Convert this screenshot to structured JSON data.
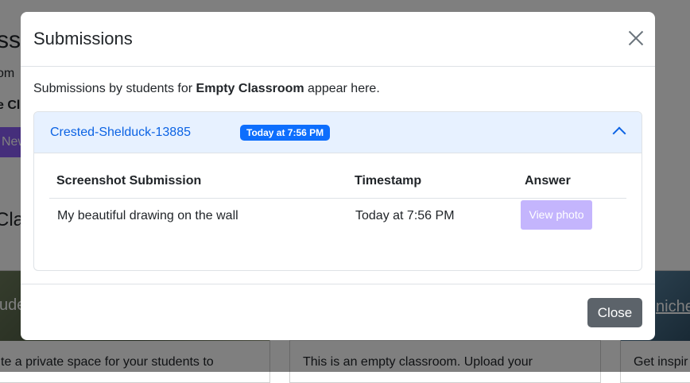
{
  "background": {
    "title_fragment": "ss",
    "line1_fragment": "om",
    "line2_fragment": "e Cl",
    "button_fragment": "New",
    "heading_fragment": "Clas",
    "cards": [
      {
        "caption": "ude",
        "text": "te a private space for your students to"
      },
      {
        "caption": "",
        "text": "This is an empty classroom. Upload your"
      },
      {
        "caption": "niche",
        "text": "Get inspir"
      }
    ]
  },
  "modal": {
    "title": "Submissions",
    "intro_prefix": "Submissions by students for ",
    "classroom_name": "Empty Classroom",
    "intro_suffix": " appear here.",
    "student": {
      "name": "Crested-Shelduck-13885",
      "badge": "Today at 7:56 PM",
      "expanded": true
    },
    "table": {
      "headers": [
        "Screenshot Submission",
        "Timestamp",
        "Answer"
      ],
      "rows": [
        {
          "submission": "My beautiful drawing on the wall",
          "timestamp": "Today at 7:56 PM",
          "answer_button": "View photo"
        }
      ]
    },
    "footer": {
      "close_label": "Close"
    }
  },
  "colors": {
    "accent": "#0d6efd",
    "accordion_bg": "#e7f1ff",
    "view_button": "#c4b5fd",
    "close_button": "#5c636a",
    "brand_purple": "#8b5cf6"
  },
  "icons": {
    "close": "close-icon",
    "collapse": "chevron-up-icon"
  }
}
